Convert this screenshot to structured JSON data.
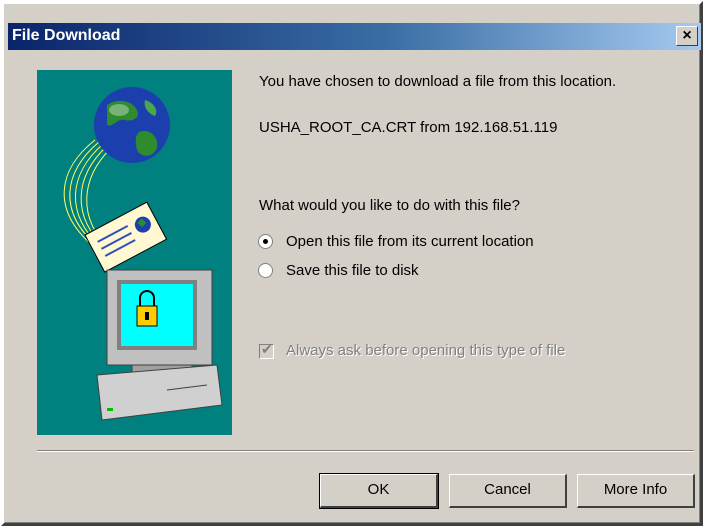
{
  "window": {
    "title": "File Download"
  },
  "message": {
    "line1": "You have chosen to download a file from this location.",
    "file_line": "USHA_ROOT_CA.CRT from 192.168.51.119",
    "question": "What would you like to do with this file?"
  },
  "options": [
    {
      "label": "Open this file from its current location",
      "selected": true
    },
    {
      "label": "Save this file to disk",
      "selected": false
    }
  ],
  "always_ask": {
    "label": "Always ask before opening this type of file",
    "checked": true,
    "enabled": false
  },
  "buttons": {
    "ok": "OK",
    "cancel": "Cancel",
    "more_info": "More Info"
  },
  "close_glyph": "×",
  "colors": {
    "title_start": "#0a246a",
    "title_end": "#a6caf0",
    "illustration_bg": "#00807f",
    "face": "#d4d0c8"
  }
}
